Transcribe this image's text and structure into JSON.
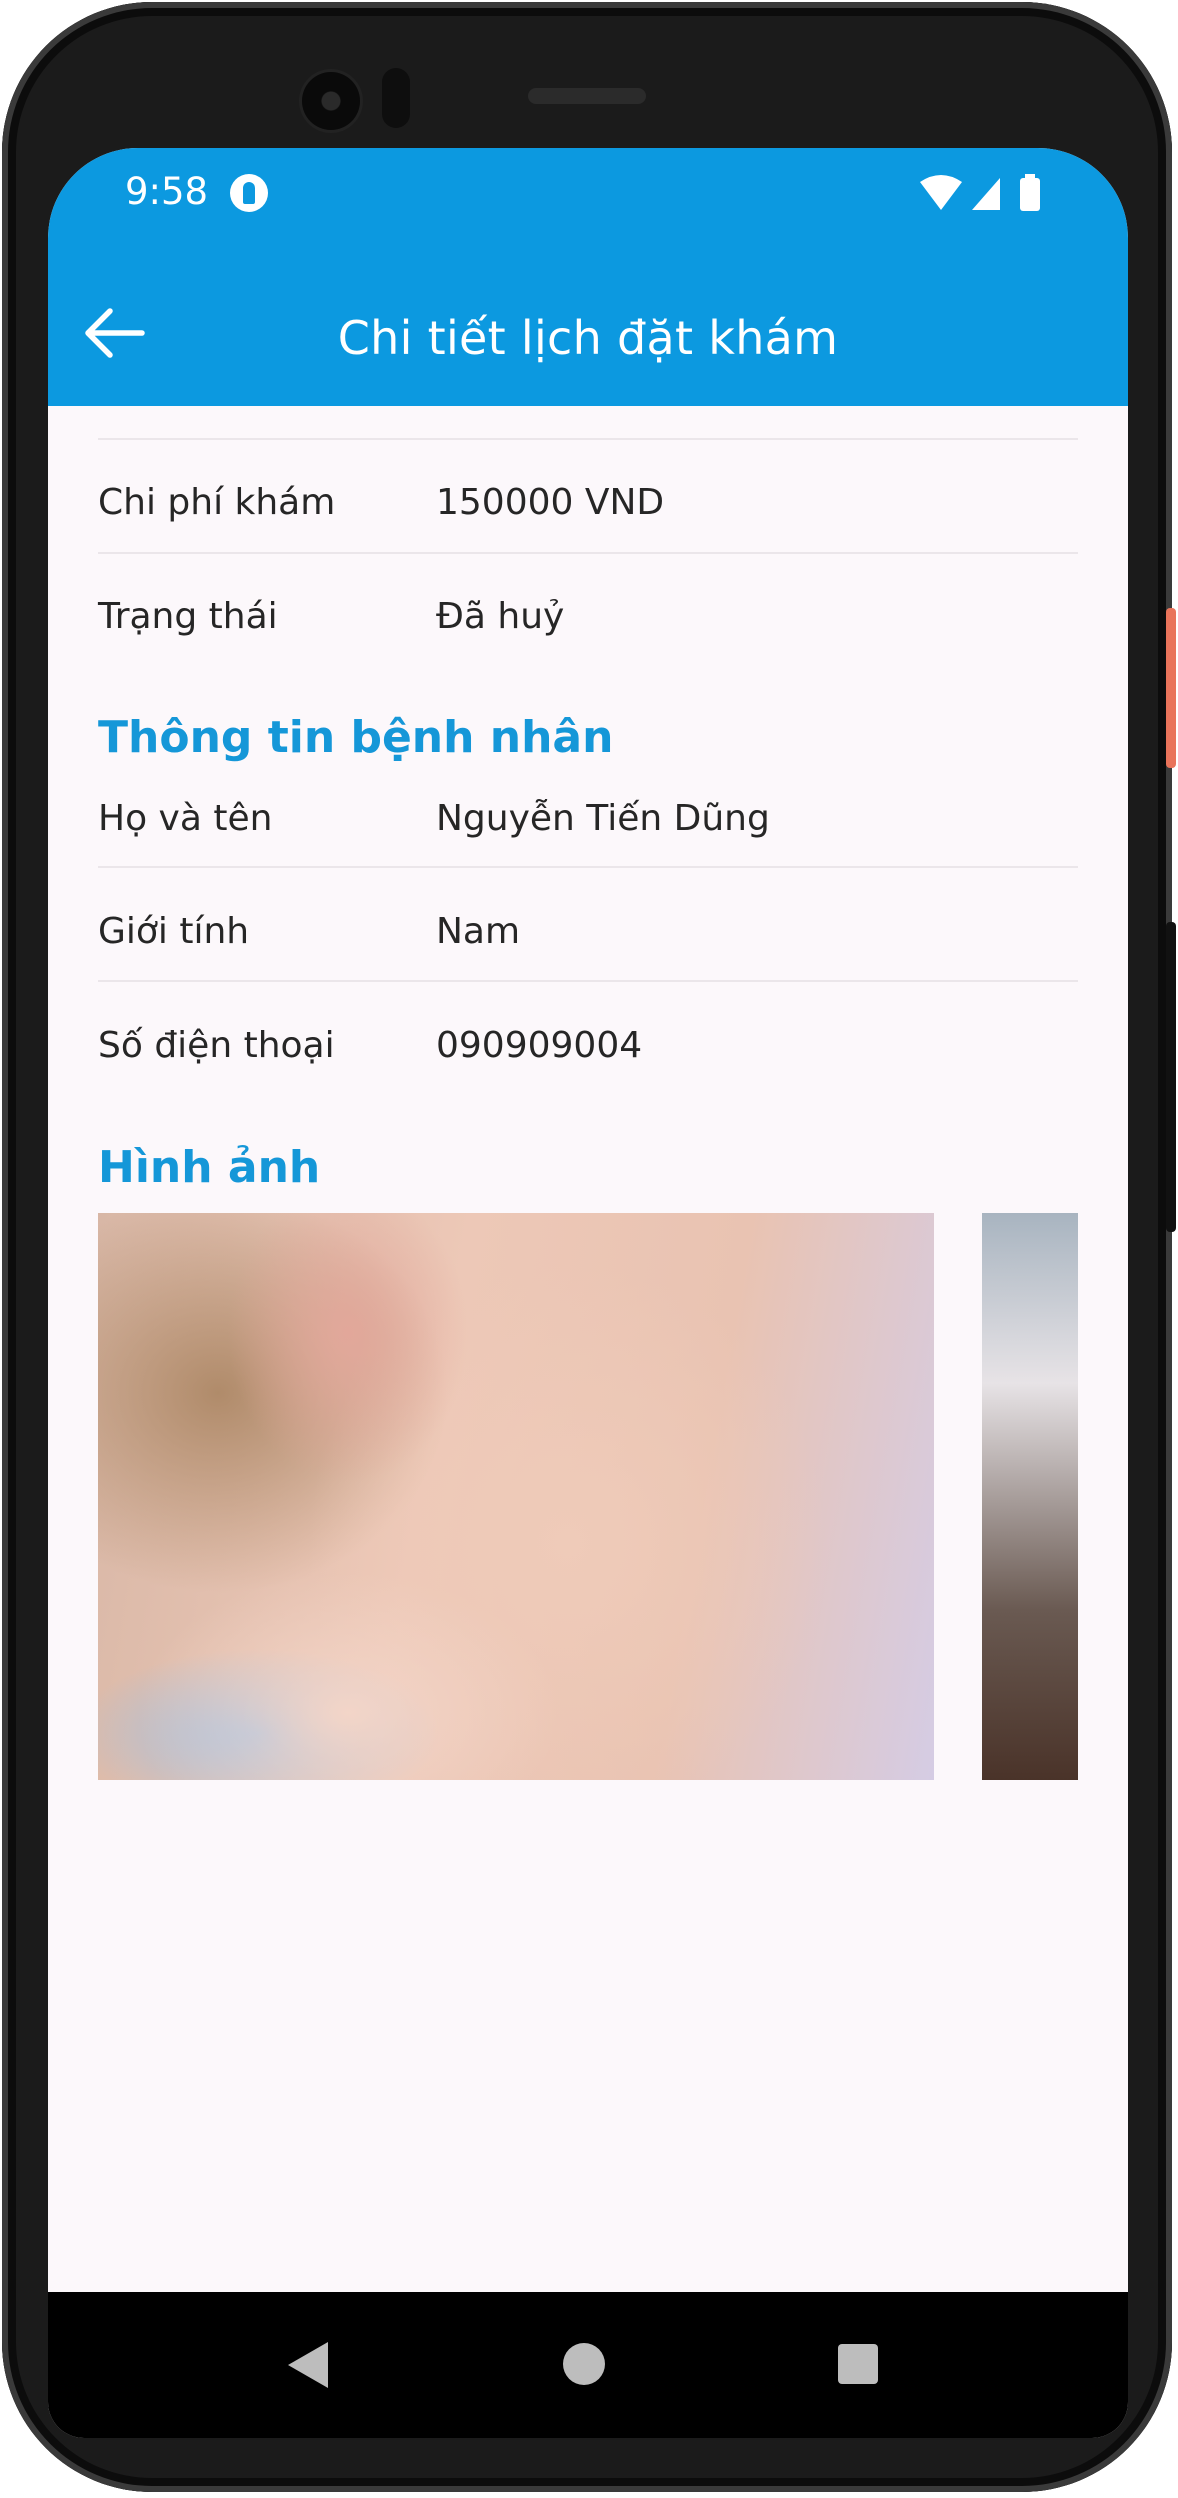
{
  "status_bar": {
    "time": "9:58"
  },
  "app_bar": {
    "title": "Chi tiết lịch đặt khám"
  },
  "appointment": {
    "fee": {
      "label": "Chi phí khám",
      "value": "150000 VND"
    },
    "status": {
      "label": "Trạng thái",
      "value": "Đã huỷ"
    }
  },
  "patient": {
    "section_title": "Thông tin bệnh nhân",
    "fields": [
      {
        "label": "Họ và tên",
        "value": "Nguyễn Tiến Dũng"
      },
      {
        "label": "Giới tính",
        "value": "Nam"
      },
      {
        "label": "Số điện thoại",
        "value": "090909004"
      }
    ]
  },
  "images": {
    "section_title": "Hình ảnh"
  },
  "colors": {
    "primary": "#0c99e0",
    "section_title": "#1597d8",
    "background": "#fcf8fb"
  },
  "icons": {
    "back": "arrow-left-icon",
    "nav_back": "triangle-back-icon",
    "nav_home": "circle-home-icon",
    "nav_recents": "square-recents-icon"
  }
}
